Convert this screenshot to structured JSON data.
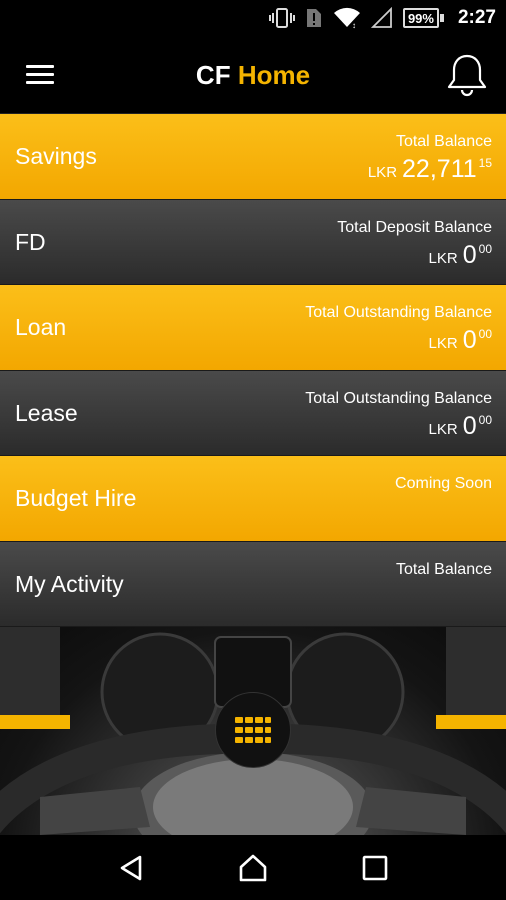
{
  "status_bar": {
    "battery": "99%",
    "time": "2:27",
    "icons": [
      "vibrate-icon",
      "sim-alert-icon",
      "wifi-icon",
      "signal-icon",
      "battery-icon"
    ]
  },
  "header": {
    "title_part1": "CF",
    "title_part2": "Home",
    "menu_icon": "menu-icon",
    "bell_icon": "bell-icon"
  },
  "rows": [
    {
      "label": "Savings",
      "caption": "Total Balance",
      "currency": "LKR",
      "amount": "22,711",
      "decimals": "15",
      "style": "gold"
    },
    {
      "label": "FD",
      "caption": "Total Deposit Balance",
      "currency": "LKR",
      "amount": "0",
      "decimals": "00",
      "style": "dark"
    },
    {
      "label": "Loan",
      "caption": "Total Outstanding Balance",
      "currency": "LKR",
      "amount": "0",
      "decimals": "00",
      "style": "gold"
    },
    {
      "label": "Lease",
      "caption": "Total Outstanding Balance",
      "currency": "LKR",
      "amount": "0",
      "decimals": "00",
      "style": "dark"
    },
    {
      "label": "Budget Hire",
      "caption": "Coming Soon",
      "style": "gold"
    },
    {
      "label": "My Activity",
      "caption": "Total Balance",
      "style": "dark"
    }
  ],
  "colors": {
    "accent": "#f5b400",
    "dark_row": "#3a3a3a",
    "background": "#000000"
  },
  "nav": {
    "icons": [
      "back-icon",
      "home-icon",
      "recents-icon"
    ]
  }
}
